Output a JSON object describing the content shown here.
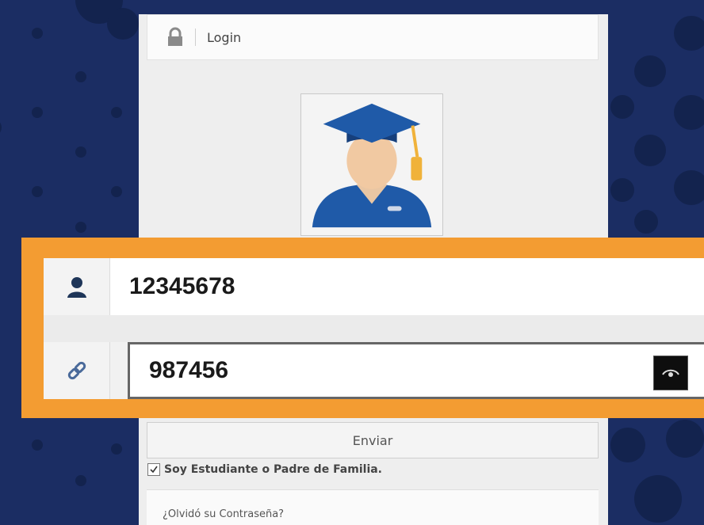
{
  "header": {
    "title": "Login",
    "icon": "lock-icon"
  },
  "avatar": {
    "icon": "graduate-avatar-icon"
  },
  "form": {
    "user_icon": "user-icon",
    "user_value": "12345678",
    "password_icon": "link-icon",
    "password_value": "987456",
    "toggle_icon": "eye-icon"
  },
  "submit_label": "Enviar",
  "checkbox": {
    "label": "Soy Estudiante o Padre de Familia.",
    "checked": true
  },
  "forgot_link": "¿Olvidó su Contraseña?",
  "colors": {
    "background": "#1b2d63",
    "highlight": "#f39c32",
    "cap": "#1f5aa8",
    "tassel": "#f0b23a"
  }
}
